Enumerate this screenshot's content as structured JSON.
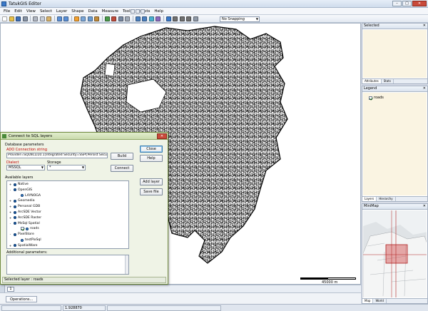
{
  "app": {
    "title": "TatukGIS Editor",
    "colors": {
      "titlebar": "#cfdcec",
      "map_background": "#ffffff",
      "panel_background": "#faf4e2",
      "close_red": "#c94a3a"
    }
  },
  "menubar": {
    "items": [
      "File",
      "Edit",
      "View",
      "Select",
      "Layer",
      "Shape",
      "Data",
      "Measure",
      "Tools",
      "Scripts",
      "Help"
    ]
  },
  "toolbar": {
    "snap_select": "No Snapping"
  },
  "map": {
    "scale_label": "45000 m"
  },
  "view_tab": {
    "label": "1"
  },
  "operations": {
    "label": "Operations..."
  },
  "statusbar": {
    "coord": "1.928870"
  },
  "right": {
    "selected": {
      "title": "Selected",
      "tabs": [
        "Attributes",
        "Stats"
      ]
    },
    "legend": {
      "title": "Legend",
      "layer": "roads",
      "tabs": [
        "Layers",
        "Hierarchy"
      ]
    },
    "minimap": {
      "title": "MiniMap",
      "tabs": [
        "Map",
        "World"
      ]
    }
  },
  "dialog": {
    "title": "Connect to SQL layers",
    "db_params_label": "Database parameters",
    "ado_label": "ADO Connection string",
    "ado_value": "Provider=SQLNCLI10.1;Integrated Security=SSPI;Persist Security",
    "build_button": "Build",
    "dialect_label": "Dialect",
    "dialect_value": "MSSQL",
    "storage_label": "Storage",
    "storage_value": "*",
    "connect_button": "Connect",
    "close_button": "Close",
    "help_button": "Help",
    "add_layer_button": "Add layer",
    "save_file_button": "Save file",
    "available_label": "Available layers",
    "tree": [
      {
        "label": "Native",
        "level": 0,
        "expander": "+"
      },
      {
        "label": "OpenGIS",
        "level": 0,
        "expander": "-"
      },
      {
        "label": "LAYNOGA",
        "level": 1,
        "expander": ""
      },
      {
        "label": "Geomedia",
        "level": 0,
        "expander": "+"
      },
      {
        "label": "Personal GDB",
        "level": 0,
        "expander": "+"
      },
      {
        "label": "ArcSDE Vector",
        "level": 0,
        "expander": "+"
      },
      {
        "label": "ArcSDE Raster",
        "level": 0,
        "expander": "+"
      },
      {
        "label": "MsSql Spatial",
        "level": 0,
        "expander": "-"
      },
      {
        "label": "roads",
        "level": 1,
        "expander": ""
      },
      {
        "label": "PixelStore",
        "level": 0,
        "expander": "-"
      },
      {
        "label": "testPixSql",
        "level": 1,
        "expander": ""
      },
      {
        "label": "SpatialWare",
        "level": 0,
        "expander": "+"
      }
    ],
    "additional_label": "Additional parameters:",
    "status": "Selected layer : roads"
  }
}
